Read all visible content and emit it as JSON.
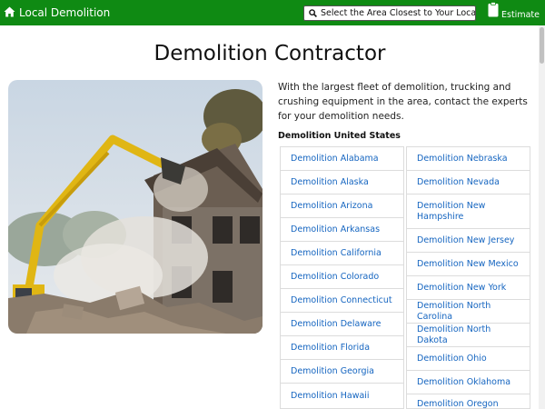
{
  "nav": {
    "brand": "Local Demolition",
    "home_icon": "home-icon",
    "location_label": "Select the Area Closest to Your Location",
    "search_icon": "search-icon",
    "estimate_label": "Estimate",
    "estimate_icon": "clipboard-icon",
    "bar_color": "#0f8a13"
  },
  "page": {
    "title": "Demolition Contractor",
    "intro": "With the largest fleet of demolition, trucking and crushing equipment in the area, contact the experts for your demolition needs.",
    "section_heading": "Demolition United States"
  },
  "states": {
    "left": [
      "Demolition Alabama",
      "Demolition Alaska",
      "Demolition Arizona",
      "Demolition Arkansas",
      "Demolition California",
      "Demolition Colorado",
      "Demolition Connecticut",
      "Demolition Delaware",
      "Demolition Florida",
      "Demolition Georgia",
      "Demolition Hawaii"
    ],
    "right": [
      "Demolition Nebraska",
      "Demolition Nevada",
      "Demolition New Hampshire",
      "Demolition New Jersey",
      "Demolition New Mexico",
      "Demolition New York",
      "Demolition North Carolina",
      "Demolition North Dakota",
      "Demolition Ohio",
      "Demolition Oklahoma",
      "Demolition Oregon"
    ]
  },
  "link_color": "#1565c0"
}
